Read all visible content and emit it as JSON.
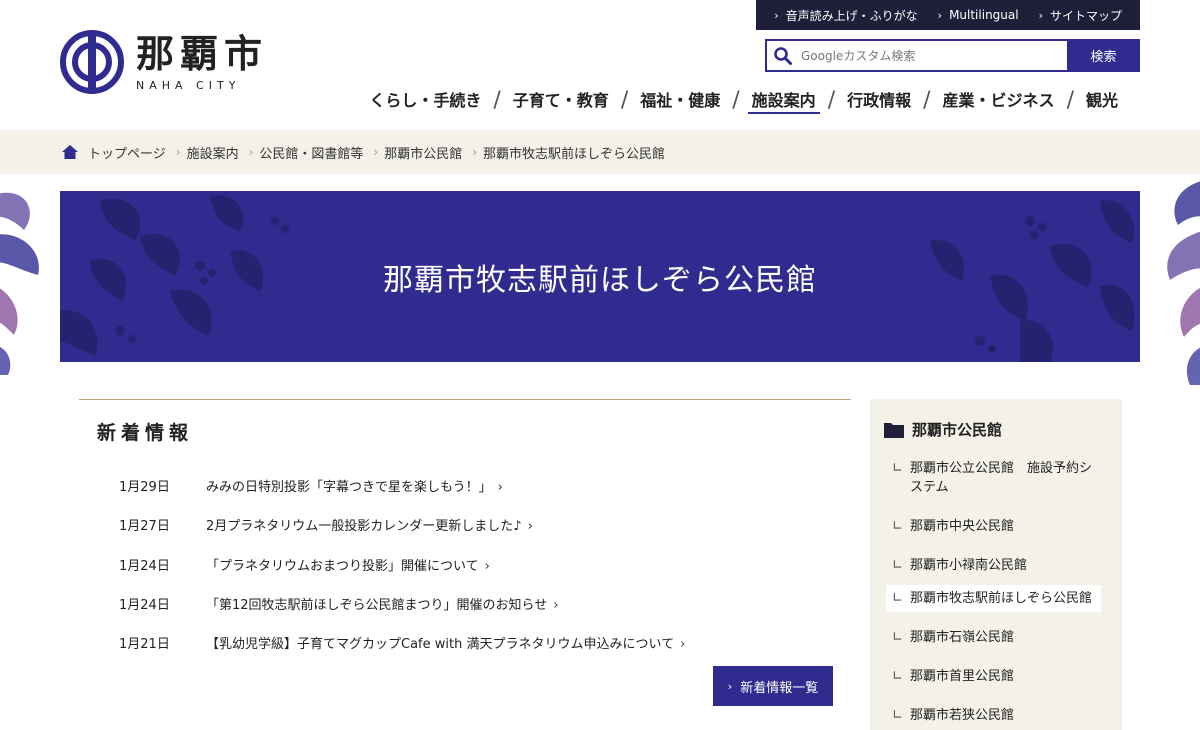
{
  "logo": {
    "name_jp": "那覇市",
    "name_en": "NAHA CITY"
  },
  "utility": [
    {
      "label": "音声読み上げ・ふりがな"
    },
    {
      "label": "Multilingual"
    },
    {
      "label": "サイトマップ"
    }
  ],
  "search": {
    "placeholder": "Googleカスタム検索",
    "button_label": "検索"
  },
  "nav": [
    {
      "label": "くらし・手続き"
    },
    {
      "label": "子育て・教育"
    },
    {
      "label": "福祉・健康"
    },
    {
      "label": "施設案内",
      "active": true
    },
    {
      "label": "行政情報"
    },
    {
      "label": "産業・ビジネス"
    },
    {
      "label": "観光"
    }
  ],
  "breadcrumb": [
    {
      "label": "トップページ"
    },
    {
      "label": "施設案内"
    },
    {
      "label": "公民館・図書館等"
    },
    {
      "label": "那覇市公民館"
    },
    {
      "label": "那覇市牧志駅前ほしぞら公民館"
    }
  ],
  "banner": {
    "title": "那覇市牧志駅前ほしぞら公民館"
  },
  "news": {
    "heading": "新着情報",
    "items": [
      {
        "date": "1月29日",
        "title": "みみの日特別投影「字幕つきで星を楽しもう！」"
      },
      {
        "date": "1月27日",
        "title": "2月プラネタリウム一般投影カレンダー更新しました♪"
      },
      {
        "date": "1月24日",
        "title": "「プラネタリウムおまつり投影」開催について"
      },
      {
        "date": "1月24日",
        "title": "「第12回牧志駅前ほしぞら公民館まつり」開催のお知らせ"
      },
      {
        "date": "1月21日",
        "title": "【乳幼児学級】子育てマグカップCafe with 満天プラネタリウム申込みについて"
      }
    ],
    "more_label": "新着情報一覧"
  },
  "sidebar": {
    "heading": "那覇市公民館",
    "items": [
      {
        "label": "那覇市公立公民館　施設予約システム"
      },
      {
        "label": "那覇市中央公民館"
      },
      {
        "label": "那覇市小禄南公民館"
      },
      {
        "label": "那覇市牧志駅前ほしぞら公民館",
        "current": true
      },
      {
        "label": "那覇市石嶺公民館"
      },
      {
        "label": "那覇市首里公民館"
      },
      {
        "label": "那覇市若狭公民館"
      }
    ]
  },
  "colors": {
    "brand": "#2f2b8f",
    "util_bg": "#1f1f3a",
    "beige": "#f3f1e8",
    "rule": "#b9a977"
  }
}
